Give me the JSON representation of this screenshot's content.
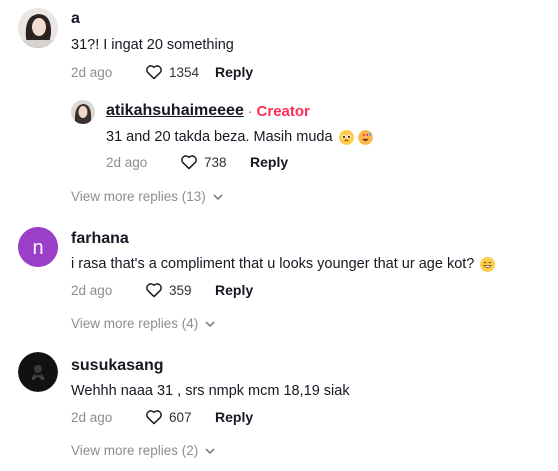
{
  "comments": [
    {
      "username": "a",
      "text": "31?! I ingat 20 something",
      "date": "2d ago",
      "likes": "1354",
      "reply_label": "Reply",
      "reply_thread": {
        "username": "atikahsuhaimeeee",
        "separator": "·",
        "badge": "Creator",
        "text": "31 and 20 takda beza. Masih muda",
        "emojis": [
          "pleading-face-emoji",
          "heart-eyes-sweat-emoji"
        ],
        "date": "2d ago",
        "likes": "738",
        "reply_label": "Reply"
      },
      "view_more": "View more replies (13)"
    },
    {
      "username": "farhana",
      "avatar_letter": "n",
      "avatar_color": "#9b3ec8",
      "text": "i rasa that's a compliment that u looks younger that ur age kot?",
      "emojis": [
        "grinning-face-emoji"
      ],
      "date": "2d ago",
      "likes": "359",
      "reply_label": "Reply",
      "view_more": "View more replies (4)"
    },
    {
      "username": "susukasang",
      "text": "Wehhh naaa 31 , srs nmpk mcm 18,19 siak",
      "date": "2d ago",
      "likes": "607",
      "reply_label": "Reply",
      "view_more": "View more replies (2)"
    }
  ],
  "colors": {
    "creator": "#fe2c55",
    "muted": "#8a8b91",
    "text": "#161823"
  }
}
